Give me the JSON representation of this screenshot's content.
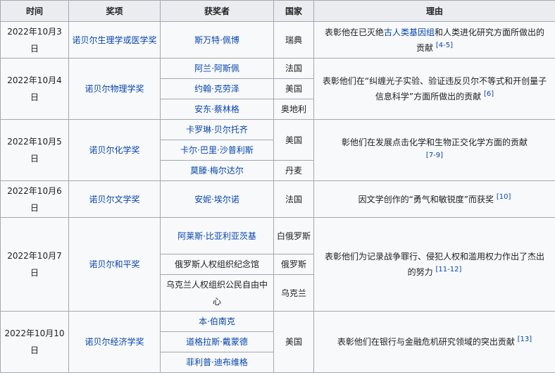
{
  "headers": [
    "时间",
    "奖项",
    "获奖者",
    "国家",
    "理由"
  ],
  "rows": [
    {
      "date": "2022年10月3日",
      "prize": "诺贝尔生理学或医学奖",
      "laureates": [
        {
          "name": "斯万特·佩博",
          "country": "瑞典"
        }
      ],
      "reason": {
        "before": "表彰他在已灭绝",
        "link": "古人类基因组",
        "after": "和人类进化研究方面所做出的贡献",
        "ref": "[4-5]"
      }
    },
    {
      "date": "2022年10月4日",
      "prize": "诺贝尔物理学奖",
      "laureates": [
        {
          "name": "阿兰·阿斯佩",
          "country": "法国"
        },
        {
          "name": "约翰·克劳泽",
          "country": "美国"
        },
        {
          "name": "安东·蔡林格",
          "country": "奥地利"
        }
      ],
      "reason": {
        "text": "表彰他们在“纠缠光子实验、验证违反贝尔不等式和开创量子信息科学”方面所做出的贡献",
        "ref": "[6]"
      }
    },
    {
      "date": "2022年10月5日",
      "prize": "诺贝尔化学奖",
      "laureates": [
        {
          "name": "卡罗琳·贝尔托齐"
        },
        {
          "name": "卡尔·巴里·沙普利斯"
        },
        {
          "name": "莫滕·梅尔达尔",
          "country": "丹麦"
        }
      ],
      "shared_country": "美国",
      "reason": {
        "text": "彰他们在发展点击化学和生物正交化学方面的贡献",
        "ref": "[7-9]"
      }
    },
    {
      "date": "2022年10月6日",
      "prize": "诺贝尔文学奖",
      "laureates": [
        {
          "name": "安妮·埃尔诺",
          "country": "法国"
        }
      ],
      "reason": {
        "text": "因文学创作的“勇气和敏锐度”而获奖",
        "ref": "[10]"
      }
    },
    {
      "date": "2022年10月7日",
      "prize": "诺贝尔和平奖",
      "laureates": [
        {
          "name": "阿莱斯·比亚利亚茨基",
          "country": "白俄罗斯"
        },
        {
          "name": "俄罗斯人权组织纪念馆",
          "country": "俄罗斯"
        },
        {
          "name": "乌克兰人权组织公民自由中心",
          "country": "乌克兰"
        }
      ],
      "reason": {
        "text": "表彰他们为记录战争罪行、侵犯人权和滥用权力作出了杰出的努力",
        "ref": "[11-12]"
      }
    },
    {
      "date": "2022年10月10日",
      "prize": "诺贝尔经济学奖",
      "laureates": [
        {
          "name": "本·伯南克"
        },
        {
          "name": "道格拉斯·戴蒙德"
        },
        {
          "name": "菲利普·迪布维格"
        }
      ],
      "shared_country": "美国",
      "reason": {
        "text": "表彰他们在银行与金融危机研究领域的突出贡献",
        "ref": "[13]"
      }
    }
  ]
}
